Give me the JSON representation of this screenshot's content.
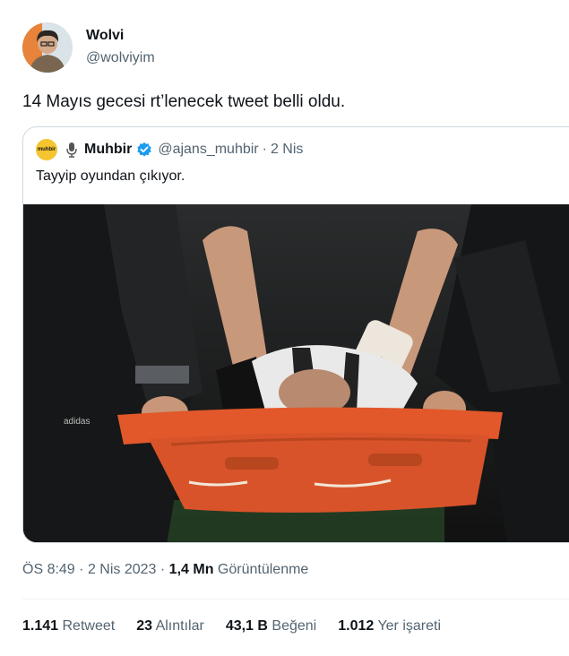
{
  "author": {
    "name": "Wolvi",
    "handle": "@wolviyim"
  },
  "tweet": {
    "text": "14 Mayıs gecesi rt’lenecek tweet belli oldu."
  },
  "quoted": {
    "logo_text": "muhbir",
    "name": "Muhbir",
    "handle": "@ajans_muhbir",
    "separator": "·",
    "date": "2 Nis",
    "text": "Tayyip oyundan çıkıyor.",
    "verified_color": "#1d9bf0"
  },
  "meta": {
    "time": "ÖS 8:49",
    "sep1": "·",
    "date": "2 Nis 2023",
    "sep2": "·",
    "views_count": "1,4 Mn",
    "views_label": "Görüntülenme"
  },
  "stats": [
    {
      "count": "1.141",
      "label": "Retweet"
    },
    {
      "count": "23",
      "label": "Alıntılar"
    },
    {
      "count": "43,1 B",
      "label": "Beğeni"
    },
    {
      "count": "1.012",
      "label": "Yer işareti"
    }
  ],
  "colors": {
    "text": "#0f1419",
    "secondary": "#536471",
    "border": "#cfd9de",
    "stretcher": "#e2582a"
  }
}
